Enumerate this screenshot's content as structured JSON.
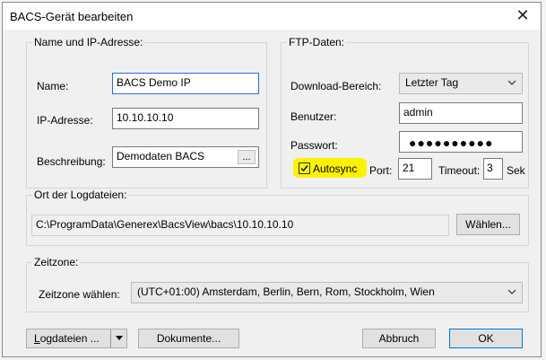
{
  "dialog": {
    "title": "BACS-Gerät bearbeiten",
    "close_glyph": "✕"
  },
  "name_group": {
    "legend": "Name und IP-Adresse:",
    "name_label": "Name:",
    "name_value": "BACS Demo IP",
    "ip_label": "IP-Adresse:",
    "ip_value": "10.10.10.10",
    "desc_label": "Beschreibung:",
    "desc_value": "Demodaten BACS",
    "desc_button": "..."
  },
  "ftp_group": {
    "legend": "FTP-Daten:",
    "download_label": "Download-Bereich:",
    "download_value": "Letzter Tag",
    "user_label": "Benutzer:",
    "user_value": "admin",
    "password_label": "Passwort:",
    "password_mask": "●●●●●●●●●●",
    "autosync_label": "Autosync",
    "autosync_checked": true,
    "port_label": "Port:",
    "port_value": "21",
    "timeout_label": "Timeout:",
    "timeout_value": "3",
    "timeout_unit": "Sek"
  },
  "log_group": {
    "legend": "Ort der Logdateien:",
    "path_value": "C:\\ProgramData\\Generex\\BacsView\\bacs\\10.10.10.10",
    "choose_button": "Wählen..."
  },
  "timezone_group": {
    "legend": "Zeitzone:",
    "select_label": "Zeitzone wählen:",
    "select_value": "(UTC+01:00) Amsterdam, Berlin, Bern, Rom, Stockholm, Wien"
  },
  "footer": {
    "logfiles_button": "ogdateien ...",
    "logfiles_button_access": "L",
    "documents_button": "Dokumente...",
    "cancel_button": "Abbruch",
    "ok_button": "OK"
  },
  "colors": {
    "highlight": "#fff200",
    "focus_border": "#2b6fd6",
    "default_button_border": "#0078d7"
  },
  "icons": {
    "dropdown": "chevron-down-icon",
    "close": "close-icon",
    "checkbox": "checkmark-icon"
  }
}
